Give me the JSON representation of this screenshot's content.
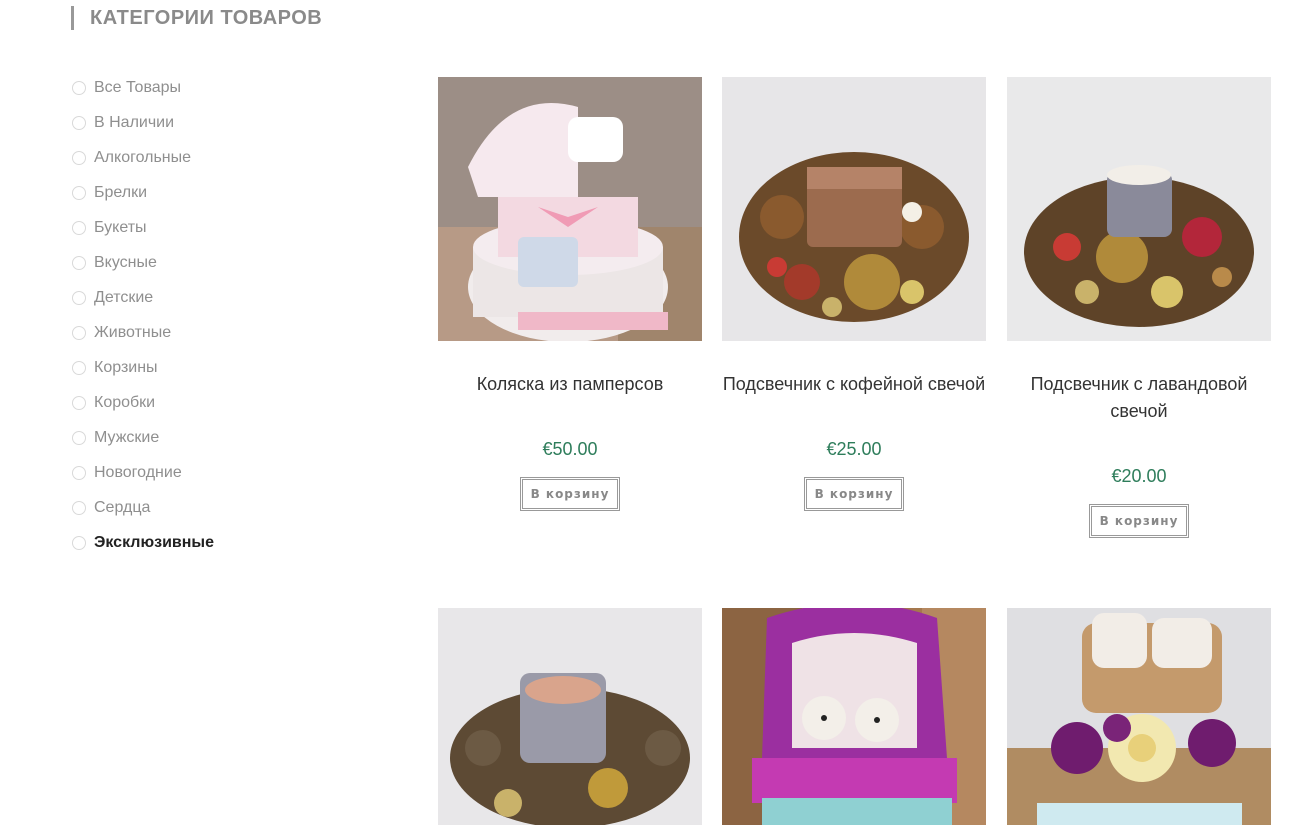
{
  "sidebar": {
    "title": "КАТЕГОРИИ ТОВАРОВ",
    "categories": [
      {
        "label": "Все Товары"
      },
      {
        "label": "В Наличии"
      },
      {
        "label": "Алкогольные"
      },
      {
        "label": "Брелки"
      },
      {
        "label": "Букеты"
      },
      {
        "label": "Вкусные"
      },
      {
        "label": "Детские"
      },
      {
        "label": "Животные"
      },
      {
        "label": "Корзины"
      },
      {
        "label": "Коробки"
      },
      {
        "label": "Мужские"
      },
      {
        "label": "Новогодние"
      },
      {
        "label": "Сердца"
      },
      {
        "label": "Эксклюзивные"
      }
    ],
    "active_index": 13
  },
  "products": [
    {
      "title": "Коляска из памперсов",
      "price": "€50.00",
      "button": "В корзину",
      "image": "diaper-stroller-cake"
    },
    {
      "title": "Подсвечник с кофейной свечой",
      "price": "€25.00",
      "button": "В корзину",
      "image": "coffee-candle-wreath"
    },
    {
      "title": "Подсвечник с лавандовой свечой",
      "price": "€20.00",
      "button": "В корзину",
      "image": "lavender-candle-wreath"
    },
    {
      "title": "",
      "price": "",
      "button": "",
      "image": "pine-cone-candle-holder"
    },
    {
      "title": "",
      "price": "",
      "button": "",
      "image": "purple-bassinet-with-bears"
    },
    {
      "title": "",
      "price": "",
      "button": "",
      "image": "slippers-with-roses-cake"
    }
  ],
  "colors": {
    "price": "#2e7d5b",
    "sidebar_title": "#8a8a8a",
    "category_text": "#8f8f8f",
    "category_active": "#222222"
  }
}
